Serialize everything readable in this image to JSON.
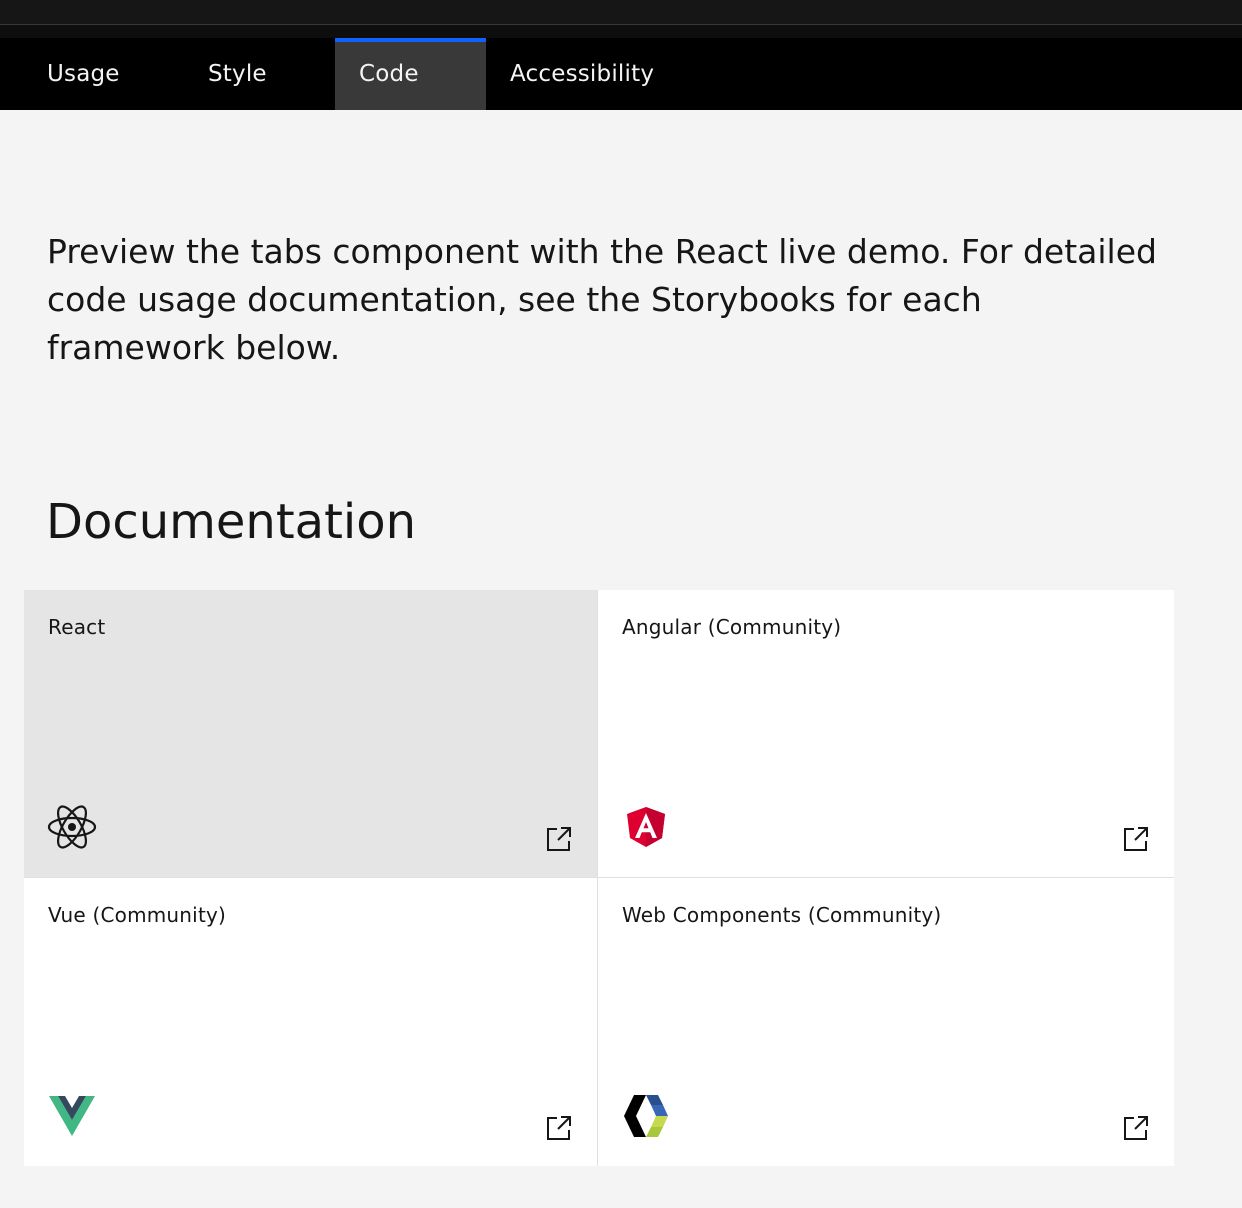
{
  "tabs": [
    {
      "label": "Usage",
      "active": false
    },
    {
      "label": "Style",
      "active": false
    },
    {
      "label": "Code",
      "active": true
    },
    {
      "label": "Accessibility",
      "active": false
    }
  ],
  "intro": "Preview the tabs component with the React live demo. For detailed code usage documentation, see the Storybooks for each framework below.",
  "documentation": {
    "heading": "Documentation",
    "cards": [
      {
        "title": "React",
        "icon": "react-icon"
      },
      {
        "title": "Angular (Community)",
        "icon": "angular-icon"
      },
      {
        "title": "Vue (Community)",
        "icon": "vue-icon"
      },
      {
        "title": "Web Components (Community)",
        "icon": "web-components-icon"
      }
    ]
  },
  "colors": {
    "active_tab_indicator": "#0f62fe",
    "active_tab_bg": "#393939",
    "page_bg": "#f4f4f4",
    "card_hover_bg": "#e5e5e5",
    "angular_red": "#dd0031",
    "vue_green": "#41b883",
    "vue_dark": "#35495e"
  }
}
